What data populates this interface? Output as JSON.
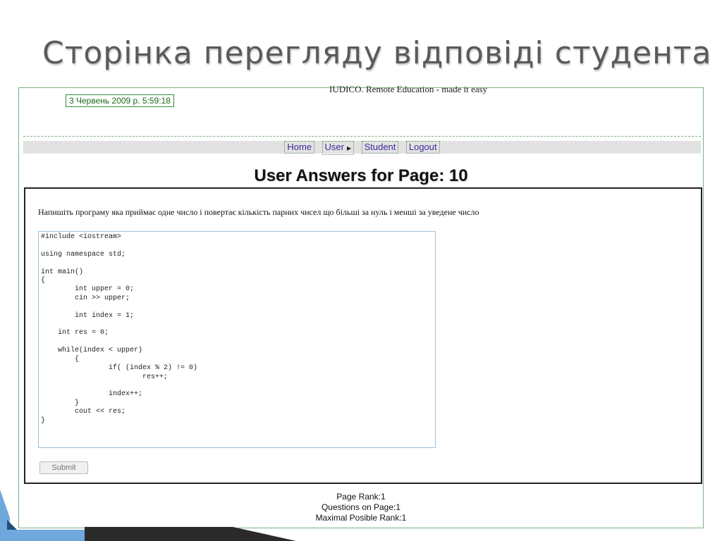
{
  "slide": {
    "title": "Сторінка перегляду відповіді студента"
  },
  "site": {
    "tagline": "IUDICO. Remote Education - made it easy",
    "date": "3 Червень 2009 р. 5:59:18"
  },
  "nav": {
    "home": "Home",
    "user": "User",
    "student": "Student",
    "logout": "Logout"
  },
  "page": {
    "heading": "User Answers for Page: 10"
  },
  "question": {
    "text": "Напишіть програму яка приймає одне число і повертає кількість парних чисел що більші за нуль і менші за уведене число"
  },
  "answer": {
    "code": "#include <iostream>\n\nusing namespace std;\n\nint main()\n{\n        int upper = 0;\n        cin >> upper;\n\n        int index = 1;\n\n    int res = 0;\n\n    while(index < upper)\n        {\n                if( (index % 2) != 0)\n                        res++;\n\n                index++;\n        }\n        cout << res;\n}"
  },
  "form": {
    "submit": "Submit"
  },
  "footer": {
    "page_rank": "Page Rank:1",
    "questions": "Questions on Page:1",
    "max_rank": "Maximal Posible Rank:1"
  },
  "colors": {
    "frame_border": "#7fb07f",
    "link": "#3a2a9a",
    "deco_dark": "#1f4e79",
    "deco_light": "#6fa8dc"
  }
}
